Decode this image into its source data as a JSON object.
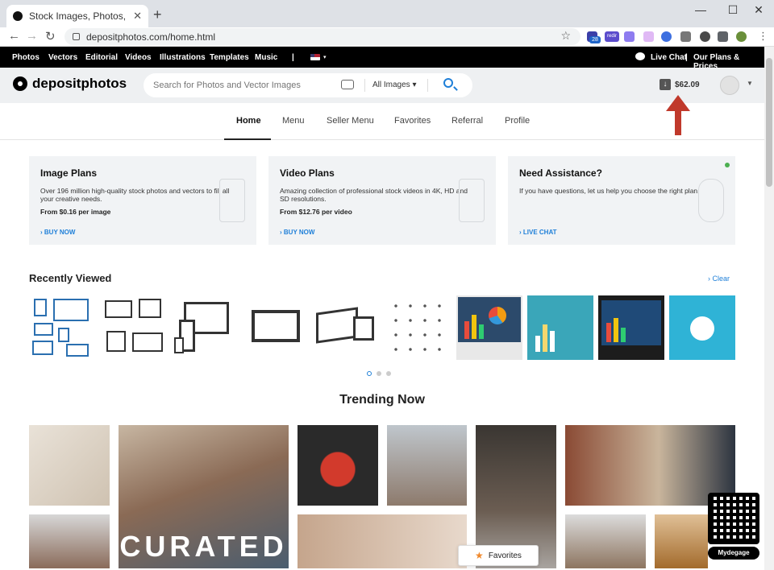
{
  "browser": {
    "tab_title": "Stock Images, Photos, Vectors, Il...",
    "tab_close": "✕",
    "new_tab": "+",
    "url": "depositphotos.com/home.html",
    "window_controls": [
      "—",
      "☐",
      "✕"
    ],
    "nav_icons": [
      "arrow-back-icon",
      "arrow-forward-icon",
      "reload-icon"
    ],
    "ext_badges": [
      "28",
      "redir"
    ]
  },
  "topnav": {
    "items": [
      "Photos",
      "Vectors",
      "Editorial",
      "Videos",
      "Illustrations",
      "Templates",
      "Music"
    ],
    "divider": "|",
    "live_chat": "Live Chat",
    "divider2": "|",
    "plans": "Our Plans & Prices"
  },
  "header": {
    "logo": "depositphotos",
    "search_placeholder": "Search for Photos and Vector Images",
    "scope": "All Images",
    "balance": "$62.09"
  },
  "subnav": {
    "items": [
      "Home",
      "Menu",
      "Seller Menu",
      "Favorites",
      "Referral",
      "Profile"
    ],
    "active": "Home"
  },
  "cards": [
    {
      "title": "Image Plans",
      "desc": "Over 196 million high-quality stock photos and vectors to fill all your creative needs.",
      "price": "From $0.16 per image",
      "cta": "BUY NOW"
    },
    {
      "title": "Video Plans",
      "desc": "Amazing collection of professional stock videos in 4K, HD and SD resolutions.",
      "price": "From $12.76 per video",
      "cta": "BUY NOW"
    },
    {
      "title": "Need Assistance?",
      "desc": "If you have questions, let us help you choose the right plan.",
      "price": "",
      "cta": "LIVE CHAT"
    }
  ],
  "recently_viewed": {
    "title": "Recently Viewed",
    "clear": "Clear",
    "page_dots": 3,
    "active_dot": 0
  },
  "trending": {
    "title": "Trending Now",
    "curated_label": "CURATED"
  },
  "floating": {
    "favorites": "Favorites",
    "qr_label": "Mydegage"
  },
  "colors": {
    "accent": "#1e7fd8",
    "annotation_arrow": "#c0392b",
    "topnav_bg": "#000000",
    "card_bg": "#f1f3f5"
  }
}
